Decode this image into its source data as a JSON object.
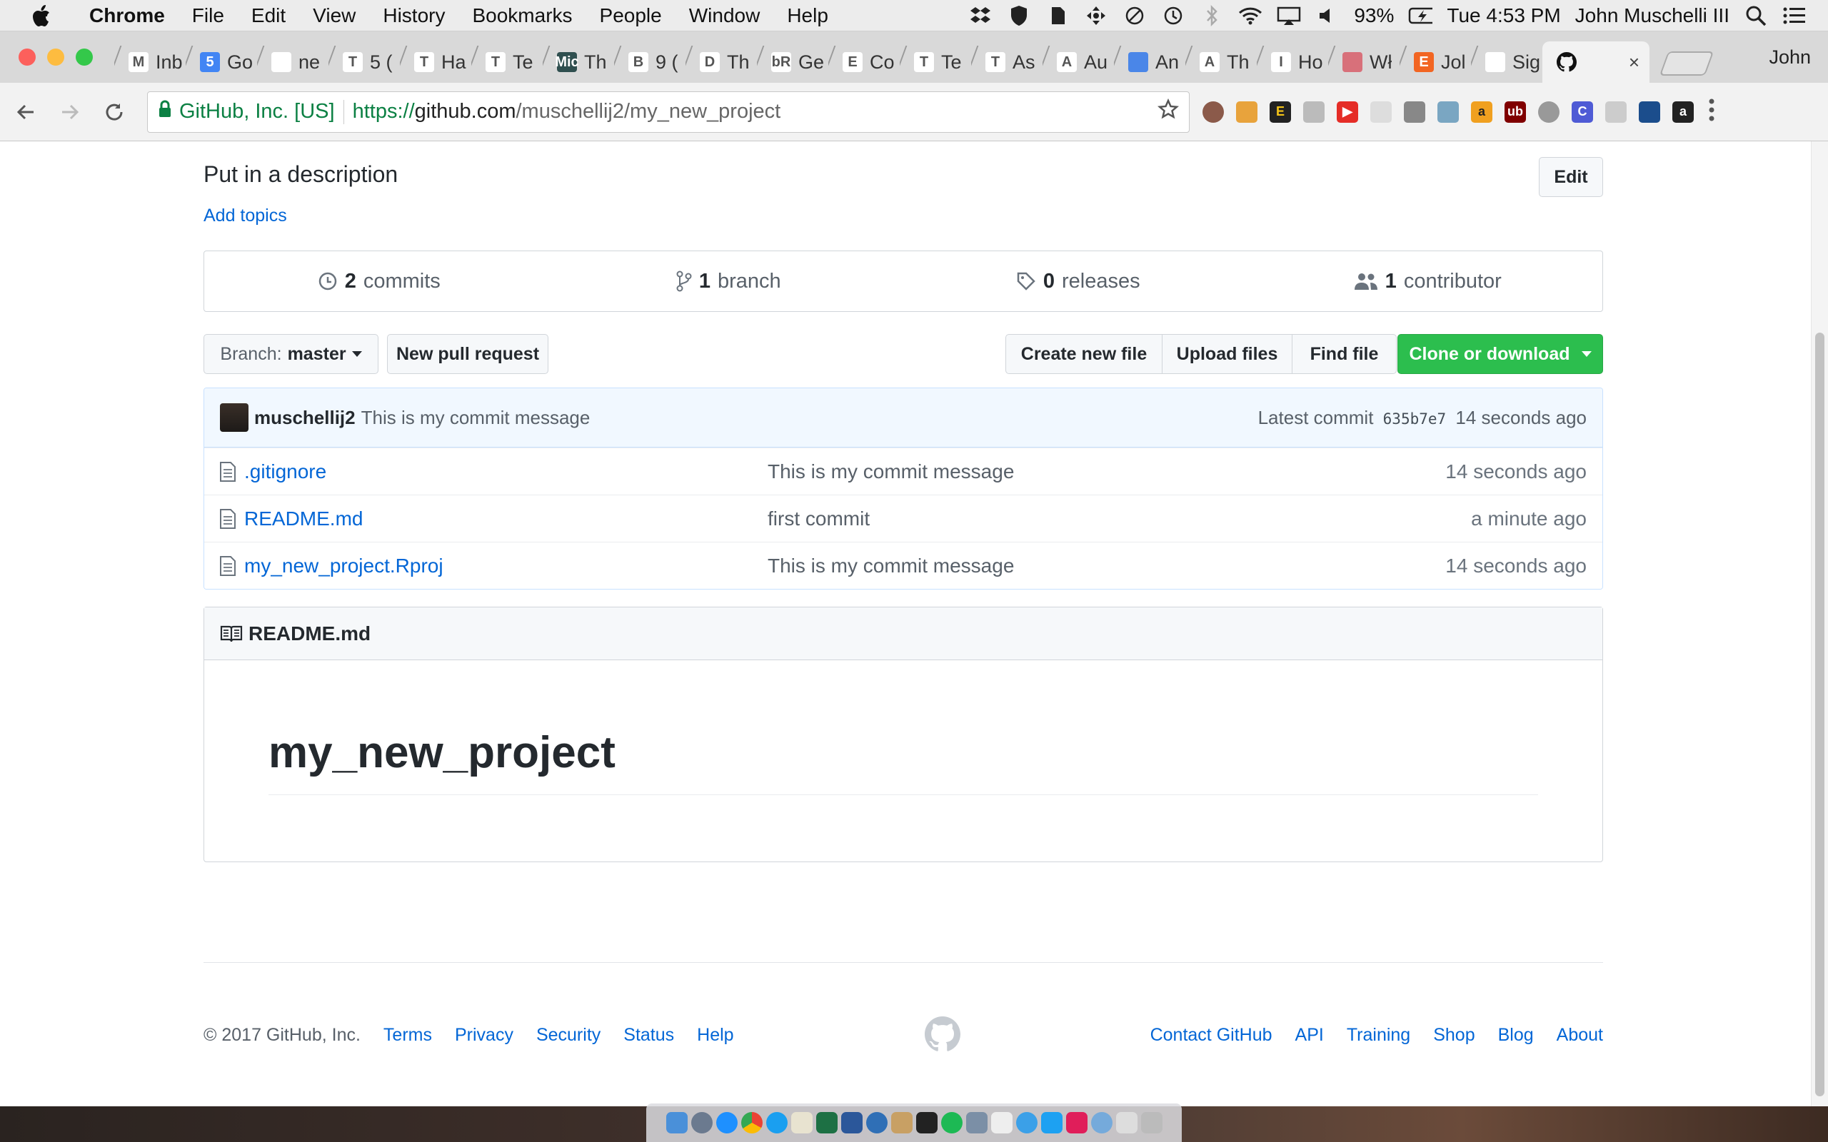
{
  "menubar": {
    "app": "Chrome",
    "items": [
      "File",
      "Edit",
      "View",
      "History",
      "Bookmarks",
      "People",
      "Window",
      "Help"
    ],
    "battery": "93%",
    "clock": "Tue 4:53 PM",
    "user": "John Muschelli III"
  },
  "tabs": [
    {
      "title": "Inb",
      "color": "#ffffff",
      "glyph": "M"
    },
    {
      "title": "Go",
      "color": "#4285f4",
      "glyph": "5"
    },
    {
      "title": "ne",
      "color": "#ffffff",
      "glyph": ""
    },
    {
      "title": "5 (",
      "color": "#ffffff",
      "glyph": "T"
    },
    {
      "title": "Ha",
      "color": "#ffffff",
      "glyph": "T"
    },
    {
      "title": "Te",
      "color": "#ffffff",
      "glyph": "T"
    },
    {
      "title": "Th",
      "color": "#2f4f4f",
      "glyph": "Mic"
    },
    {
      "title": "9 (",
      "color": "#ffffff",
      "glyph": "B"
    },
    {
      "title": "Th",
      "color": "#ffffff",
      "glyph": "D"
    },
    {
      "title": "Ge",
      "color": "#ffffff",
      "glyph": "bR"
    },
    {
      "title": "Co",
      "color": "#ffffff",
      "glyph": "E"
    },
    {
      "title": "Te",
      "color": "#ffffff",
      "glyph": "T"
    },
    {
      "title": "As",
      "color": "#ffffff",
      "glyph": "T"
    },
    {
      "title": "Au",
      "color": "#ffffff",
      "glyph": "A"
    },
    {
      "title": "An",
      "color": "#4a86e8",
      "glyph": ""
    },
    {
      "title": "Th",
      "color": "#ffffff",
      "glyph": "A"
    },
    {
      "title": "Ho",
      "color": "#ffffff",
      "glyph": "I"
    },
    {
      "title": "Wł",
      "color": "#d8707a",
      "glyph": ""
    },
    {
      "title": "Jol",
      "color": "#f26522",
      "glyph": "E"
    },
    {
      "title": "Sig",
      "color": "#ffffff",
      "glyph": ""
    }
  ],
  "active_tab": {
    "close": "×"
  },
  "profile_name": "John",
  "omnibox": {
    "secure_label": "GitHub, Inc. [US]",
    "scheme": "https://",
    "host": "github.com",
    "path": "/muschellij2/my_new_project"
  },
  "repo": {
    "description": "Put in a description",
    "add_topics": "Add topics",
    "edit_label": "Edit",
    "numbers": {
      "commits_count": "2",
      "commits_label": "commits",
      "branch_count": "1",
      "branch_label": "branch",
      "releases_count": "0",
      "releases_label": "releases",
      "contributor_count": "1",
      "contributor_label": "contributor"
    },
    "branch_prefix": "Branch:",
    "branch_name": "master",
    "new_pull_request": "New pull request",
    "create_new_file": "Create new file",
    "upload_files": "Upload files",
    "find_file": "Find file",
    "clone_or_download": "Clone or download",
    "latest_commit": {
      "author": "muschellij2",
      "message": "This is my commit message",
      "prefix": "Latest commit",
      "sha": "635b7e7",
      "age": "14 seconds ago"
    },
    "files": [
      {
        "name": ".gitignore",
        "message": "This is my commit message",
        "age": "14 seconds ago"
      },
      {
        "name": "README.md",
        "message": "first commit",
        "age": "a minute ago"
      },
      {
        "name": "my_new_project.Rproj",
        "message": "This is my commit message",
        "age": "14 seconds ago"
      }
    ],
    "readme": {
      "header": "README.md",
      "heading": "my_new_project"
    }
  },
  "footer": {
    "copyright": "© 2017 GitHub, Inc.",
    "left_links": [
      "Terms",
      "Privacy",
      "Security",
      "Status",
      "Help"
    ],
    "right_links": [
      "Contact GitHub",
      "API",
      "Training",
      "Shop",
      "Blog",
      "About"
    ]
  },
  "colors": {
    "link": "#0366d6",
    "green_button": "#2cbe4e",
    "commit_bar": "#f1f8ff"
  }
}
